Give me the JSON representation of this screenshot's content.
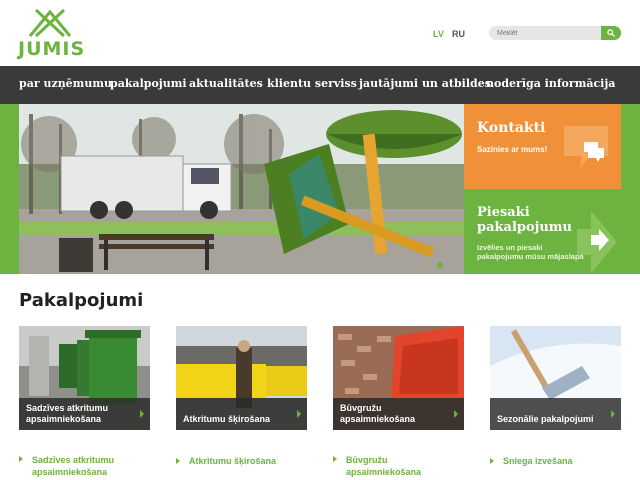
{
  "header": {
    "logo_text": "JUMIS",
    "lang": [
      "LV",
      "RU"
    ],
    "search": {
      "placeholder": "Meklēt"
    }
  },
  "nav": {
    "items": [
      "par uzņēmumu",
      "pakalpojumi",
      "aktualitātes",
      "klientu serviss",
      "jautājumi un atbildes",
      "noderīga informācija"
    ]
  },
  "hero": {
    "kontakti": {
      "title": "Kontakti",
      "subtitle": "Sazinies ar mums!"
    },
    "piesaki": {
      "title": "Piesaki pakalpojumu",
      "subtitle": "Izvēlies un piesaki pakalpojumu mūsu mājaslapā"
    }
  },
  "services": {
    "title": "Pakalpojumi",
    "cards": [
      {
        "caption": "Sadzīves atkritumu apsaimniekošana"
      },
      {
        "caption": "Atkritumu šķirošana"
      },
      {
        "caption": "Būvgružu apsaimniekošana"
      },
      {
        "caption": "Sezonālie pakalpojumi"
      }
    ],
    "links": [
      "Sadzīves atkritumu apsaimniekošana",
      "Atkritumu šķirošana",
      "Būvgružu apsaimniekošana",
      "Sniega izvešana"
    ]
  },
  "colors": {
    "brand_green": "#6db33f",
    "orange": "#f0913a",
    "nav_bg": "#3a3a3a"
  }
}
